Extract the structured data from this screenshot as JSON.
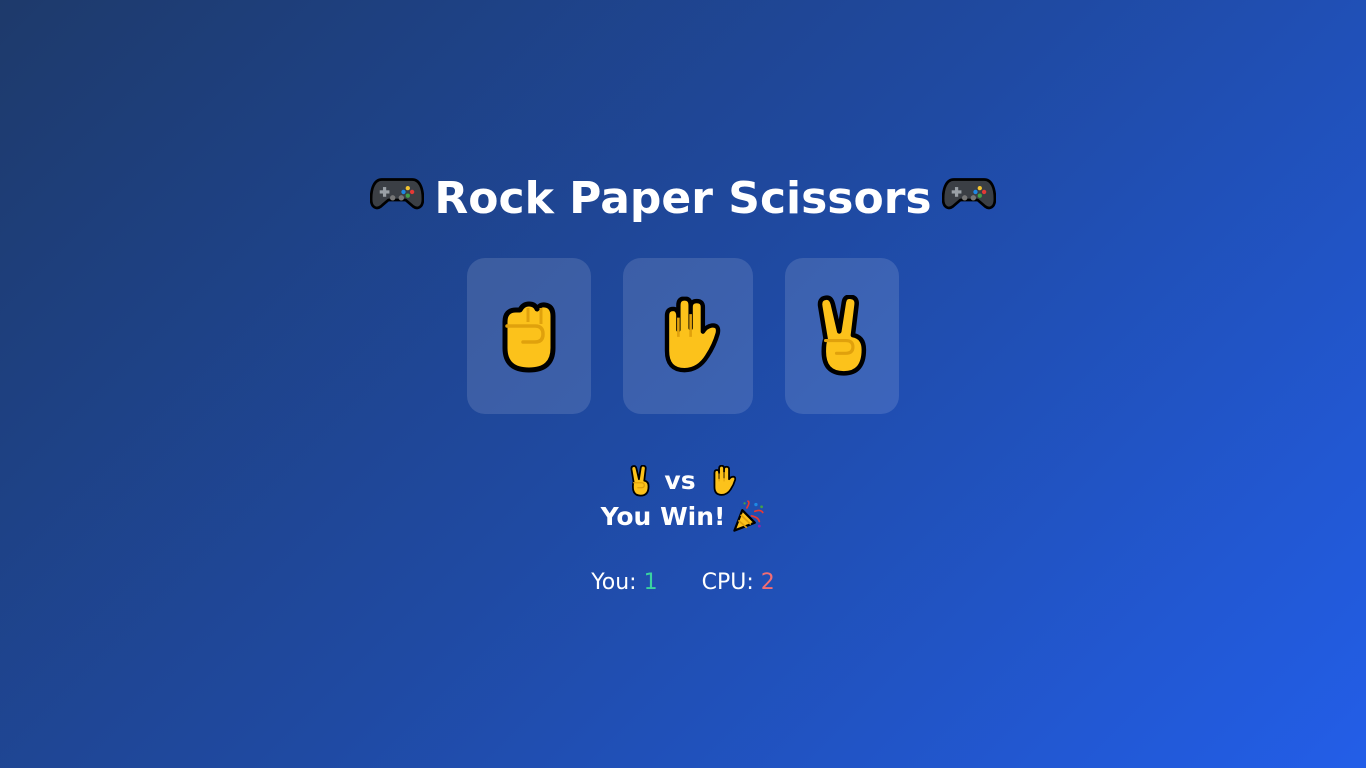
{
  "header": {
    "title": "Rock Paper Scissors",
    "left_icon": "game-controller-icon",
    "right_icon": "game-controller-icon"
  },
  "choices": [
    {
      "name": "rock",
      "icon": "raised-fist-icon"
    },
    {
      "name": "paper",
      "icon": "raised-hand-icon"
    },
    {
      "name": "scissors",
      "icon": "victory-hand-icon"
    }
  ],
  "result": {
    "player_choice_icon": "victory-hand-icon",
    "vs_label": "vs",
    "cpu_choice_icon": "raised-hand-icon",
    "outcome": "You Win!",
    "outcome_icon": "party-popper-icon"
  },
  "scores": {
    "you_label": "You: ",
    "you_value": "1",
    "cpu_label": "CPU: ",
    "cpu_value": "2"
  },
  "colors": {
    "background_start": "#1e3a6b",
    "background_end": "#235ee8",
    "hand_fill": "#fcc21b",
    "hand_detail": "#e0a10c",
    "you_score": "#3ad3a0",
    "cpu_score": "#f26d73"
  }
}
